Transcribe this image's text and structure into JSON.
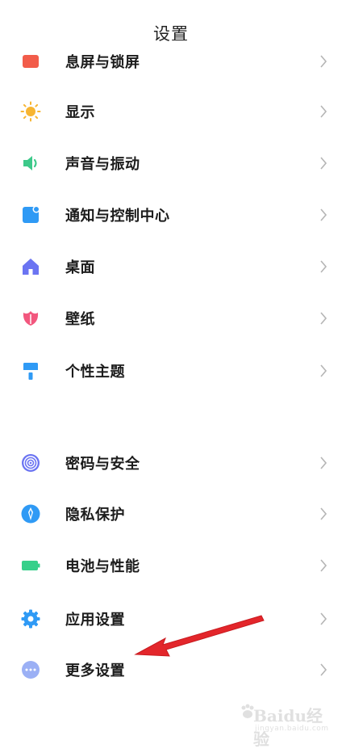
{
  "header": {
    "title": "设置"
  },
  "items_group1": [
    {
      "label": "息屏与锁屏",
      "icon": "lock-screen-icon",
      "color": "#f25c4a"
    },
    {
      "label": "显示",
      "icon": "sun-icon",
      "color": "#f7b533"
    },
    {
      "label": "声音与振动",
      "icon": "speaker-icon",
      "color": "#3dc98a"
    },
    {
      "label": "通知与控制中心",
      "icon": "notification-icon",
      "color": "#2f9af5"
    },
    {
      "label": "桌面",
      "icon": "home-icon",
      "color": "#6b74f2"
    },
    {
      "label": "壁纸",
      "icon": "tulip-icon",
      "color": "#f2577e"
    },
    {
      "label": "个性主题",
      "icon": "brush-icon",
      "color": "#2f9af5"
    }
  ],
  "items_group2": [
    {
      "label": "密码与安全",
      "icon": "fingerprint-icon",
      "color": "#6b74f2"
    },
    {
      "label": "隐私保护",
      "icon": "privacy-shield-icon",
      "color": "#2f9af5"
    },
    {
      "label": "电池与性能",
      "icon": "battery-icon",
      "color": "#36d08a"
    },
    {
      "label": "应用设置",
      "icon": "gear-icon",
      "color": "#2f9af5"
    },
    {
      "label": "更多设置",
      "icon": "more-dots-icon",
      "color": "#9bb0f5"
    }
  ],
  "watermark": {
    "text": "Baidu经验",
    "url": "jingyan.baidu.com"
  }
}
